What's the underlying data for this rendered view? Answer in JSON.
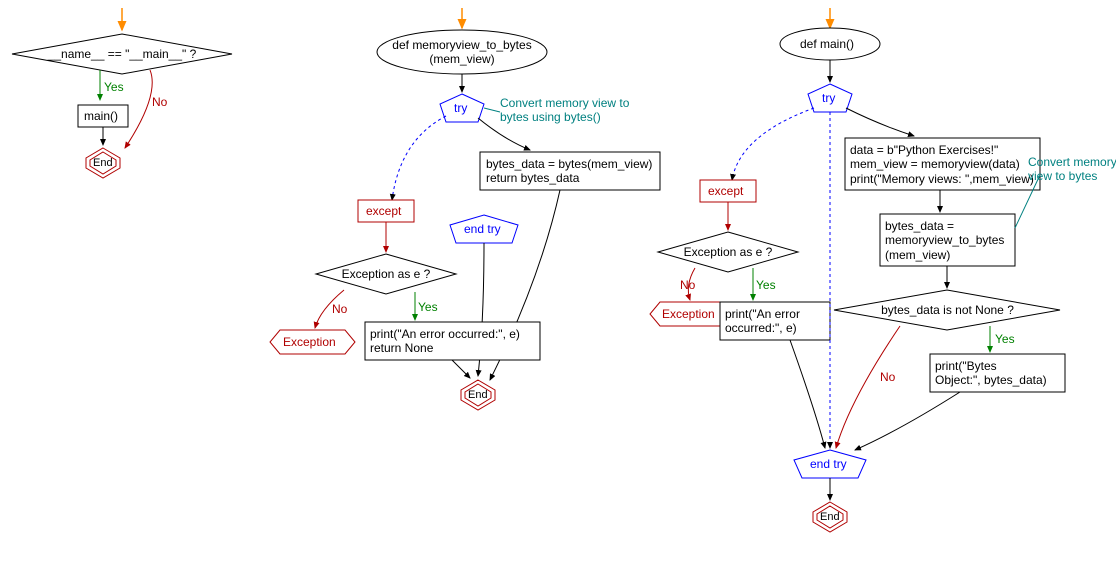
{
  "flow1": {
    "entry_arrow": "↓",
    "decision1": "__name__ == \"__main__\" ?",
    "decision1_yes": "Yes",
    "decision1_no": "No",
    "proc_main": "main()",
    "end_label": "End"
  },
  "flow2": {
    "func_def": "def memoryview_to_bytes\n(mem_view)",
    "try_label": "try",
    "comment1": "Convert memory view to\nbytes using bytes()",
    "proc_bytes": "bytes_data = bytes(mem_view)\nreturn bytes_data",
    "endtry_label": "end try",
    "except_label": "except",
    "decision_exc": "Exception as e ?",
    "dec_no": "No",
    "dec_yes": "Yes",
    "exception_box": "Exception",
    "proc_print": "print(\"An error occurred:\", e)\nreturn None",
    "end_label": "End"
  },
  "flow3": {
    "func_def": "def main()",
    "try_label": "try",
    "except_label": "except",
    "proc_data": "data = b\"Python Exercises!\"\nmem_view = memoryview(data)\nprint(\"Memory views: \",mem_view)",
    "comment2": "Convert memory\nview to bytes",
    "proc_bytes2": "bytes_data =\nmemoryview_to_bytes\n(mem_view)",
    "decision_none": "bytes_data is not None ?",
    "dec_yes": "Yes",
    "dec_no": "No",
    "proc_print_bytes": "print(\"Bytes\nObject:\", bytes_data)",
    "decision_exc2": "Exception as e ?",
    "proc_err": "print(\"An error\noccurred:\", e)",
    "exception_box": "Exception",
    "endtry_label": "end try",
    "end_label": "End"
  }
}
